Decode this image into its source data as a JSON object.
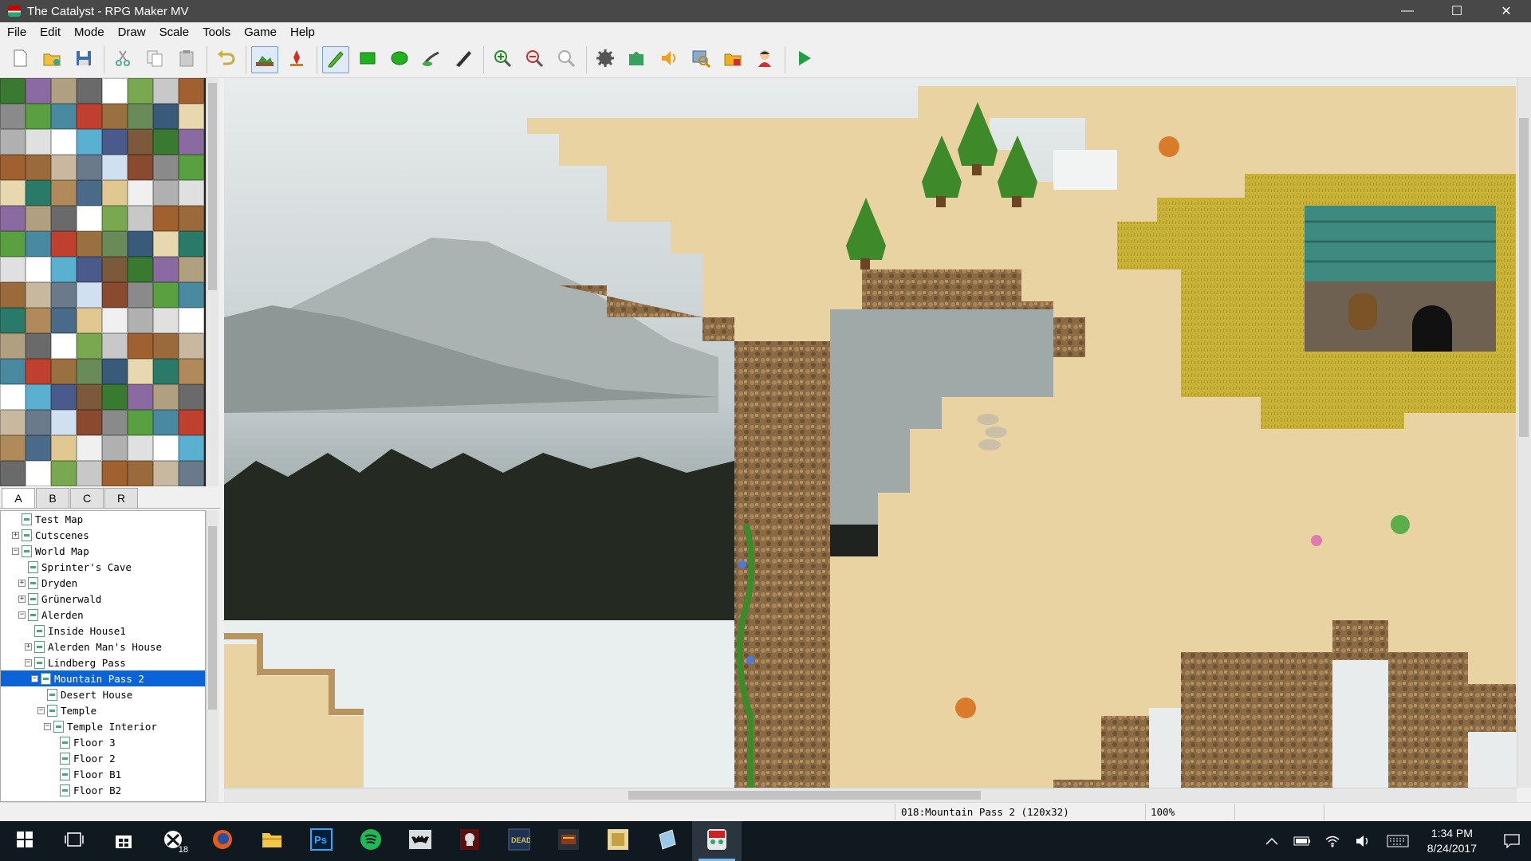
{
  "window": {
    "title": "The Catalyst - RPG Maker MV",
    "minimize": "—",
    "maximize": "☐",
    "close": "✕"
  },
  "menu": [
    "File",
    "Edit",
    "Mode",
    "Draw",
    "Scale",
    "Tools",
    "Game",
    "Help"
  ],
  "toolbar": [
    {
      "name": "new-project",
      "icon": "new-document-icon"
    },
    {
      "name": "open-project",
      "icon": "open-folder-icon"
    },
    {
      "name": "save-project",
      "icon": "save-icon"
    },
    {
      "sep": true
    },
    {
      "name": "cut",
      "icon": "scissors-icon"
    },
    {
      "name": "copy",
      "icon": "copy-icon"
    },
    {
      "name": "paste",
      "icon": "paste-icon"
    },
    {
      "sep": true
    },
    {
      "name": "undo",
      "icon": "undo-icon"
    },
    {
      "sep": true
    },
    {
      "name": "map-mode",
      "icon": "map-mode-icon",
      "active": true
    },
    {
      "name": "event-mode",
      "icon": "event-mode-icon"
    },
    {
      "sep": true
    },
    {
      "name": "pencil",
      "icon": "pencil-icon",
      "active": true
    },
    {
      "name": "rectangle",
      "icon": "rectangle-icon"
    },
    {
      "name": "ellipse",
      "icon": "ellipse-icon"
    },
    {
      "name": "flood-fill",
      "icon": "fill-icon"
    },
    {
      "name": "shadow-pen",
      "icon": "shadow-pen-icon"
    },
    {
      "sep": true
    },
    {
      "name": "zoom-in",
      "icon": "zoom-in-icon"
    },
    {
      "name": "zoom-out",
      "icon": "zoom-out-icon"
    },
    {
      "name": "actual-size",
      "icon": "zoom-actual-icon"
    },
    {
      "sep": true
    },
    {
      "name": "database",
      "icon": "gear-icon"
    },
    {
      "name": "plugin-manager",
      "icon": "plugin-icon"
    },
    {
      "name": "sound-test",
      "icon": "speaker-icon"
    },
    {
      "name": "event-searcher",
      "icon": "search-icon"
    },
    {
      "name": "resource-manager",
      "icon": "resource-folder-icon"
    },
    {
      "name": "character-generator",
      "icon": "character-icon"
    },
    {
      "sep": true
    },
    {
      "name": "playtest",
      "icon": "play-icon"
    }
  ],
  "tileset_tabs": [
    "A",
    "B",
    "C",
    "R"
  ],
  "active_tileset_tab": "A",
  "map_tree": [
    {
      "label": "Test Map",
      "level": 0,
      "expander": "none"
    },
    {
      "label": "Cutscenes",
      "level": 0,
      "expander": "plus"
    },
    {
      "label": "World Map",
      "level": 0,
      "expander": "minus"
    },
    {
      "label": "Sprinter's Cave",
      "level": 1,
      "expander": "none"
    },
    {
      "label": "Dryden",
      "level": 1,
      "expander": "plus"
    },
    {
      "label": "Grünerwald",
      "level": 1,
      "expander": "plus"
    },
    {
      "label": "Alerden",
      "level": 1,
      "expander": "minus"
    },
    {
      "label": "Inside House1",
      "level": 2,
      "expander": "none"
    },
    {
      "label": "Alerden Man's House",
      "level": 2,
      "expander": "plus"
    },
    {
      "label": "Lindberg Pass",
      "level": 2,
      "expander": "minus"
    },
    {
      "label": "Mountain Pass 2",
      "level": 3,
      "expander": "minus",
      "selected": true
    },
    {
      "label": "Desert House",
      "level": 4,
      "expander": "none"
    },
    {
      "label": "Temple",
      "level": 4,
      "expander": "minus"
    },
    {
      "label": "Temple Interior",
      "level": 5,
      "expander": "minus"
    },
    {
      "label": "Floor 3",
      "level": 6,
      "expander": "none"
    },
    {
      "label": "Floor 2",
      "level": 6,
      "expander": "none"
    },
    {
      "label": "Floor B1",
      "level": 6,
      "expander": "none"
    },
    {
      "label": "Floor B2",
      "level": 6,
      "expander": "none"
    }
  ],
  "status": {
    "map_info": "018:Mountain Pass 2 (120x32)",
    "zoom": "100%"
  },
  "taskbar": {
    "apps": [
      {
        "name": "start",
        "icon": "windows-start-icon"
      },
      {
        "name": "task-view",
        "icon": "task-view-icon"
      },
      {
        "name": "store",
        "icon": "store-icon"
      },
      {
        "name": "xbox",
        "icon": "xbox-icon",
        "badge": "18"
      },
      {
        "name": "firefox",
        "icon": "firefox-icon"
      },
      {
        "name": "file-explorer",
        "icon": "folder-icon"
      },
      {
        "name": "photoshop",
        "icon": "photoshop-icon",
        "text": "Ps"
      },
      {
        "name": "spotify",
        "icon": "spotify-icon"
      },
      {
        "name": "app-batman",
        "icon": "batman-icon"
      },
      {
        "name": "app-game1",
        "icon": "game-skull-icon"
      },
      {
        "name": "app-game2",
        "icon": "game-dead-icon"
      },
      {
        "name": "app-game3",
        "icon": "game-book-icon"
      },
      {
        "name": "app-game4",
        "icon": "game-box-icon"
      },
      {
        "name": "app-paper",
        "icon": "paper-icon"
      },
      {
        "name": "rpg-maker",
        "icon": "rpg-maker-icon",
        "active": true
      }
    ],
    "clock": {
      "time": "1:34 PM",
      "date": "8/24/2017"
    }
  },
  "colors": {
    "selection": "#0a64d8",
    "taskbar": "#101820",
    "titlebar": "#484848"
  }
}
